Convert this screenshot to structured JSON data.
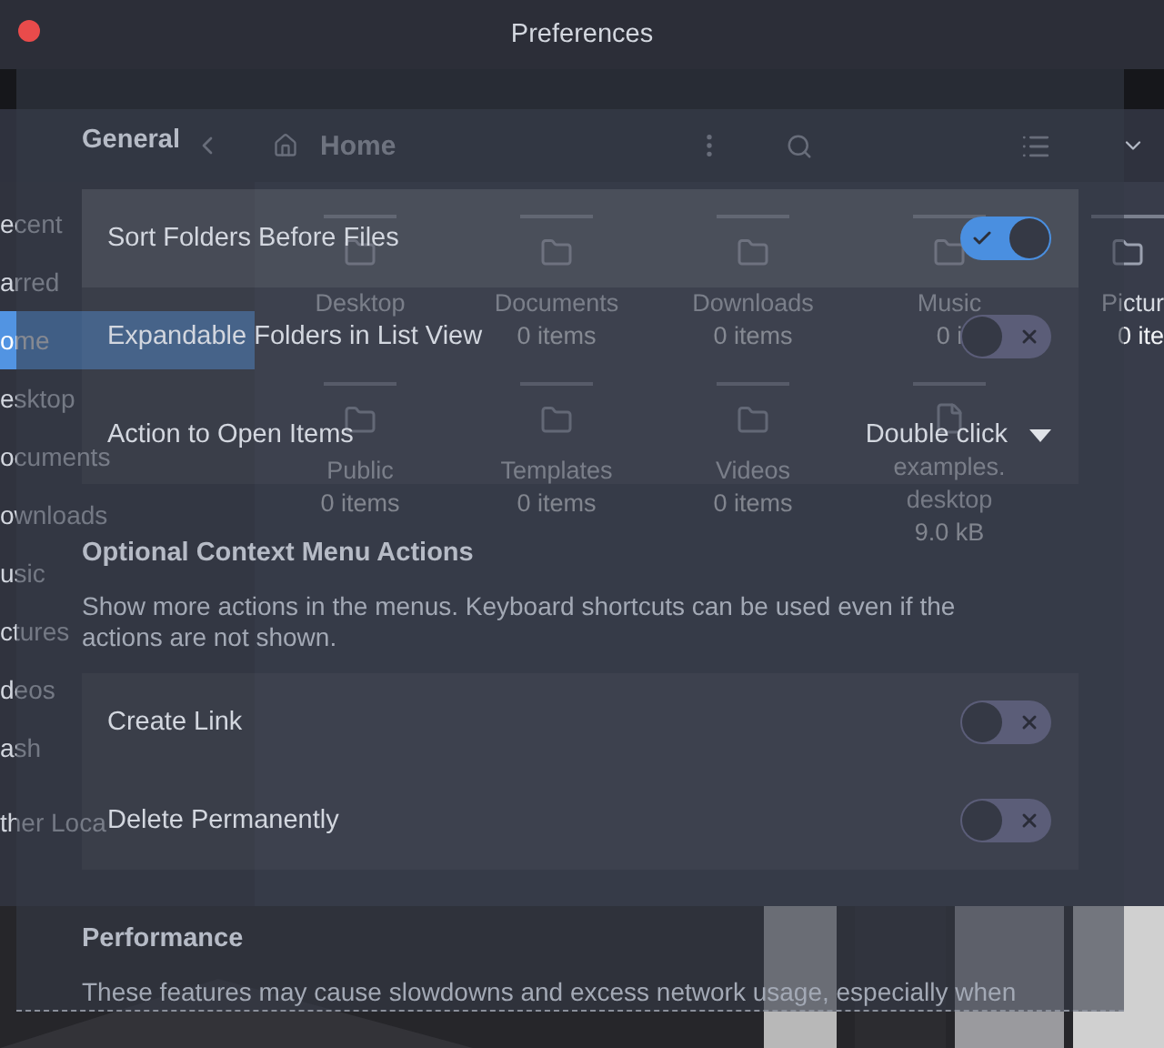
{
  "file_manager": {
    "path": "Home",
    "sidebar": [
      {
        "label": "ecent",
        "selected": false
      },
      {
        "label": "arred",
        "selected": false
      },
      {
        "label": "ome",
        "selected": true
      },
      {
        "label": "esktop",
        "selected": false
      },
      {
        "label": "ocuments",
        "selected": false
      },
      {
        "label": "ownloads",
        "selected": false
      },
      {
        "label": "usic",
        "selected": false
      },
      {
        "label": "ctures",
        "selected": false
      },
      {
        "label": "deos",
        "selected": false
      },
      {
        "label": "ash",
        "selected": false
      },
      {
        "label": "ther Loca",
        "selected": false
      }
    ],
    "files": [
      {
        "kind": "folder",
        "name": "Desktop"
      },
      {
        "kind": "folder",
        "name": "Documents",
        "info": "0 items"
      },
      {
        "kind": "folder",
        "name": "Downloads",
        "info": "0 items"
      },
      {
        "kind": "folder",
        "name": "Music",
        "info": "0 i"
      },
      {
        "kind": "folder",
        "name": "Pictur",
        "info": "0 ite"
      },
      {
        "kind": "folder",
        "name": "Public",
        "info": "0 items"
      },
      {
        "kind": "folder",
        "name": "Templates",
        "info": "0 items"
      },
      {
        "kind": "folder",
        "name": "Videos",
        "info": "0 items"
      },
      {
        "kind": "file",
        "name": "examples.\ndesktop",
        "info": "9.0 kB"
      }
    ]
  },
  "dialog": {
    "title": "Preferences",
    "sections": [
      {
        "title": "General",
        "rows": [
          {
            "kind": "switch",
            "label": "Sort Folders Before Files",
            "on": true,
            "hovered": true
          },
          {
            "kind": "switch",
            "label": "Expandable Folders in List View",
            "on": false,
            "hovered": false
          },
          {
            "kind": "dropdown",
            "label": "Action to Open Items",
            "value": "Double click",
            "hovered": false
          }
        ]
      },
      {
        "title": "Optional Context Menu Actions",
        "description": "Show more actions in the menus. Keyboard shortcuts can be used even if the actions are not shown.",
        "rows": [
          {
            "kind": "switch",
            "label": "Create Link",
            "on": false,
            "hovered": false
          },
          {
            "kind": "switch",
            "label": "Delete Permanently",
            "on": false,
            "hovered": false
          }
        ]
      },
      {
        "title": "Performance",
        "description": "These features may cause slowdowns and excess network usage, especially when"
      }
    ]
  }
}
